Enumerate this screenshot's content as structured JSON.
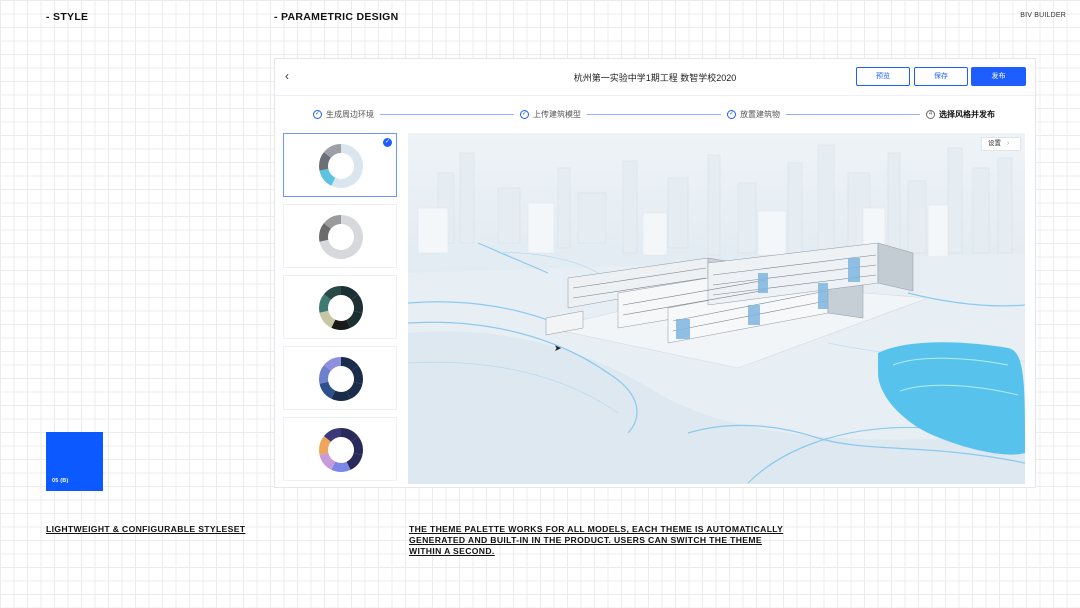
{
  "header": {
    "left": "- STYLE",
    "middle": "- PARAMETRIC DESIGN",
    "right": "BIV BUILDER"
  },
  "app": {
    "back_icon": "chevron-left-icon",
    "title": "杭州第一实验中学1期工程 数智学校2020",
    "buttons": {
      "preview": "预览",
      "save": "保存",
      "publish": "发布"
    },
    "colors": {
      "accent": "#1e5eff"
    },
    "steps": [
      {
        "label": "生成周边环境",
        "marker": "✓",
        "state": "done"
      },
      {
        "label": "上传建筑模型",
        "marker": "✓",
        "state": "done"
      },
      {
        "label": "放置建筑物",
        "marker": "✓",
        "state": "done"
      },
      {
        "label": "选择风格并发布",
        "marker": "4",
        "state": "active"
      }
    ],
    "themes": [
      {
        "selected": true,
        "colors": [
          "#dbe5ee",
          "#dbe5ee",
          "#dbe5ee",
          "#dbe5ee",
          "#5ec3e0",
          "#6a7075",
          "#9aa0a6"
        ],
        "check_icon": "check-icon"
      },
      {
        "selected": false,
        "colors": [
          "#d6d8db",
          "#d6d8db",
          "#d6d8db",
          "#d6d8db",
          "#d6d8db",
          "#6b6b6b",
          "#9a9a9a"
        ]
      },
      {
        "selected": false,
        "colors": [
          "#1c2f33",
          "#1c2f33",
          "#1c2f33",
          "#1a1a1a",
          "#c7c7a6",
          "#3f7a72",
          "#2a4a48"
        ]
      },
      {
        "selected": false,
        "colors": [
          "#1b2b4a",
          "#1b2b4a",
          "#1b2b4a",
          "#1b2b4a",
          "#2d4f8a",
          "#6d7fcf",
          "#8f8fe0"
        ]
      },
      {
        "selected": false,
        "colors": [
          "#2a2a5a",
          "#2a2a5a",
          "#2a2a5a",
          "#7a86e8",
          "#c79ad8",
          "#f0a65a",
          "#3a3a7a"
        ]
      }
    ],
    "viewport": {
      "settings_label": "设置",
      "settings_arrow": "›",
      "cursor_icon": "cursor-arrow-icon"
    }
  },
  "badge": {
    "label": "05 (B)",
    "color": "#0c59ff"
  },
  "captions": {
    "left": "LIGHTWEIGHT & CONFIGURABLE STYLESET",
    "right": "THE THEME PALETTE WORKS FOR ALL MODELS, EACH THEME IS AUTOMATICALLY GENERATED AND BUILT-IN IN THE PRODUCT. USERS CAN SWITCH THE THEME WITHIN A SECOND."
  }
}
